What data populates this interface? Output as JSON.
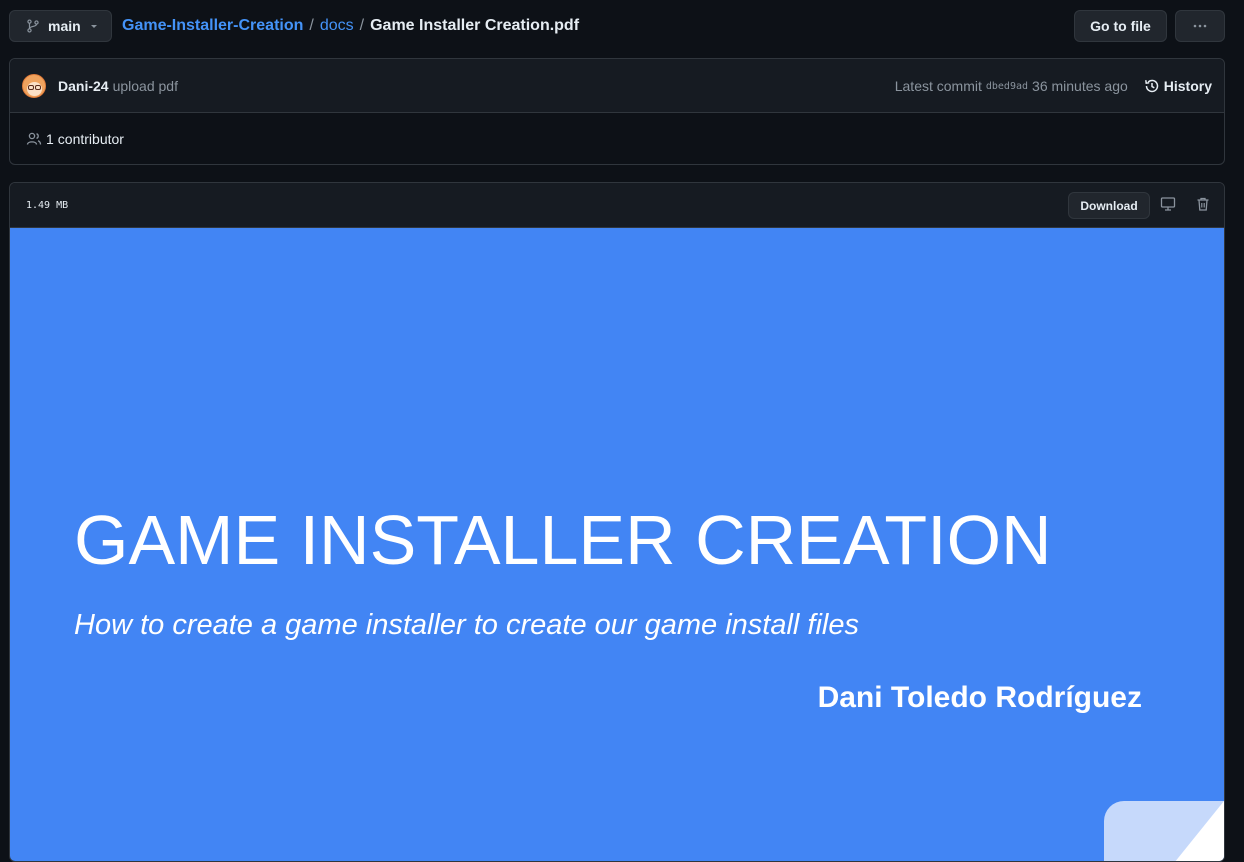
{
  "topbar": {
    "branch": "main",
    "breadcrumb": {
      "repo": "Game-Installer-Creation",
      "folder": "docs",
      "file": "Game Installer Creation.pdf",
      "separator": "/"
    },
    "go_to_file": "Go to file"
  },
  "commit": {
    "author": "Dani-24",
    "message": "upload pdf",
    "latest_label": "Latest commit",
    "sha": "dbed9ad",
    "time": "36 minutes ago",
    "history": "History"
  },
  "contributors": {
    "count": "1",
    "label": "contributor"
  },
  "file": {
    "size": "1.49 MB",
    "download": "Download"
  },
  "slide": {
    "title": "GAME INSTALLER CREATION",
    "subtitle": "How to create a game installer to create our game install files",
    "author": "Dani Toledo Rodríguez",
    "background": "#4285f4"
  },
  "colors": {
    "bg": "#0d1117",
    "panel": "#161b22",
    "border": "#30363d",
    "link": "#4493f8"
  }
}
